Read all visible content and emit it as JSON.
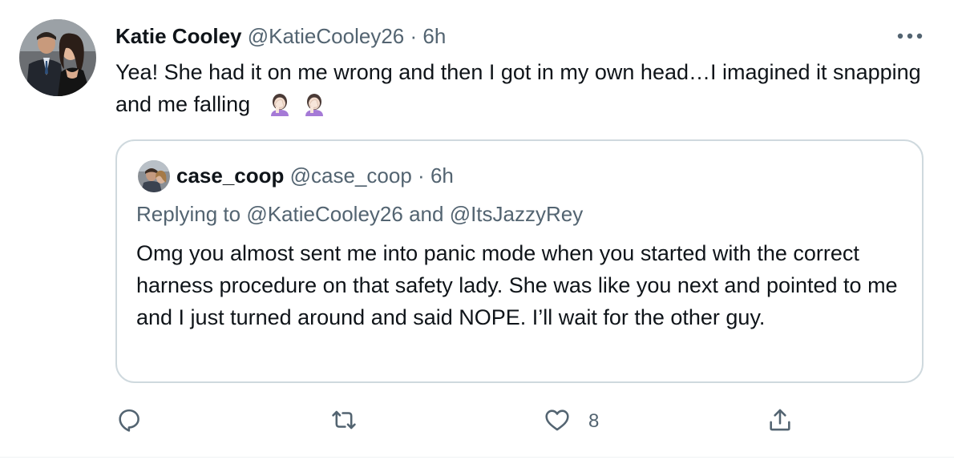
{
  "tweet": {
    "author_name": "Katie Cooley",
    "author_handle": "@KatieCooley26",
    "separator": "·",
    "time": "6h",
    "text": "Yea! She had it on me wrong and then I got in my own head…I imagined it snapping and me falling",
    "emojis": [
      "woman-facepalming-icon",
      "woman-facepalming-icon"
    ],
    "more_icon": "ellipsis-icon"
  },
  "quote": {
    "author_name": "case_coop",
    "author_handle": "@case_coop",
    "separator": "·",
    "time": "6h",
    "reply_prefix": "Replying to",
    "reply_user_1": "@KatieCooley26",
    "reply_and": "and",
    "reply_user_2": "@ItsJazzyRey",
    "text": "Omg you almost sent me into panic mode when you started with the correct harness procedure on that safety lady. She was like you next and pointed to me and I just turned around and said NOPE. I’ll wait for the other guy."
  },
  "actions": {
    "reply_icon": "reply-icon",
    "retweet_icon": "retweet-icon",
    "like_icon": "like-icon",
    "like_count": "8",
    "share_icon": "share-icon"
  },
  "colors": {
    "text_primary": "#0f1419",
    "text_secondary": "#536471",
    "border": "#cfd9de"
  }
}
